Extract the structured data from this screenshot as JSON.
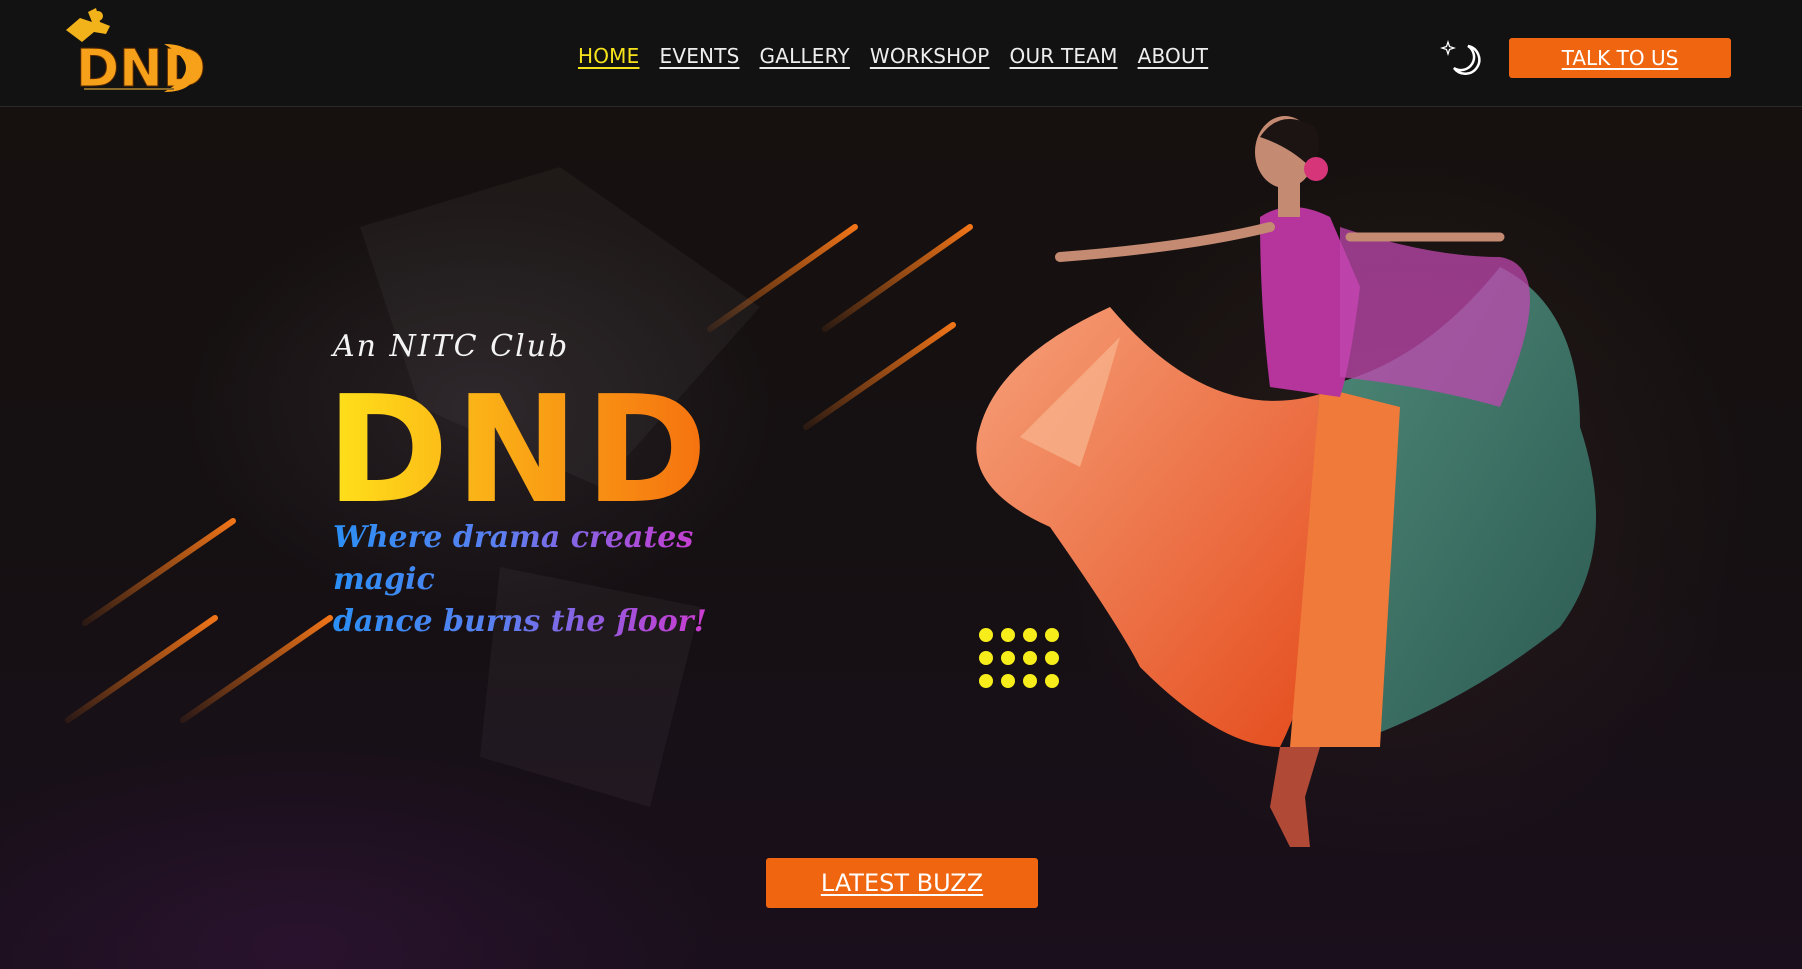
{
  "header": {
    "logo_text": "DND",
    "nav": [
      {
        "label": "HOME",
        "active": true
      },
      {
        "label": "EVENTS",
        "active": false
      },
      {
        "label": "GALLERY",
        "active": false
      },
      {
        "label": "WORKSHOP",
        "active": false
      },
      {
        "label": "OUR TEAM",
        "active": false
      },
      {
        "label": "ABOUT",
        "active": false
      }
    ],
    "theme_icon": "moon-stars-icon",
    "cta_label": "TALK TO US"
  },
  "hero": {
    "tag": "An NITC Club",
    "title": "DND",
    "tagline_line1": "Where drama creates magic",
    "tagline_line2": "dance burns the floor!",
    "button_label": "LATEST BUZZ"
  },
  "colors": {
    "accent_orange": "#f0650f",
    "active_nav": "#f6e21b",
    "background": "#120e11"
  }
}
